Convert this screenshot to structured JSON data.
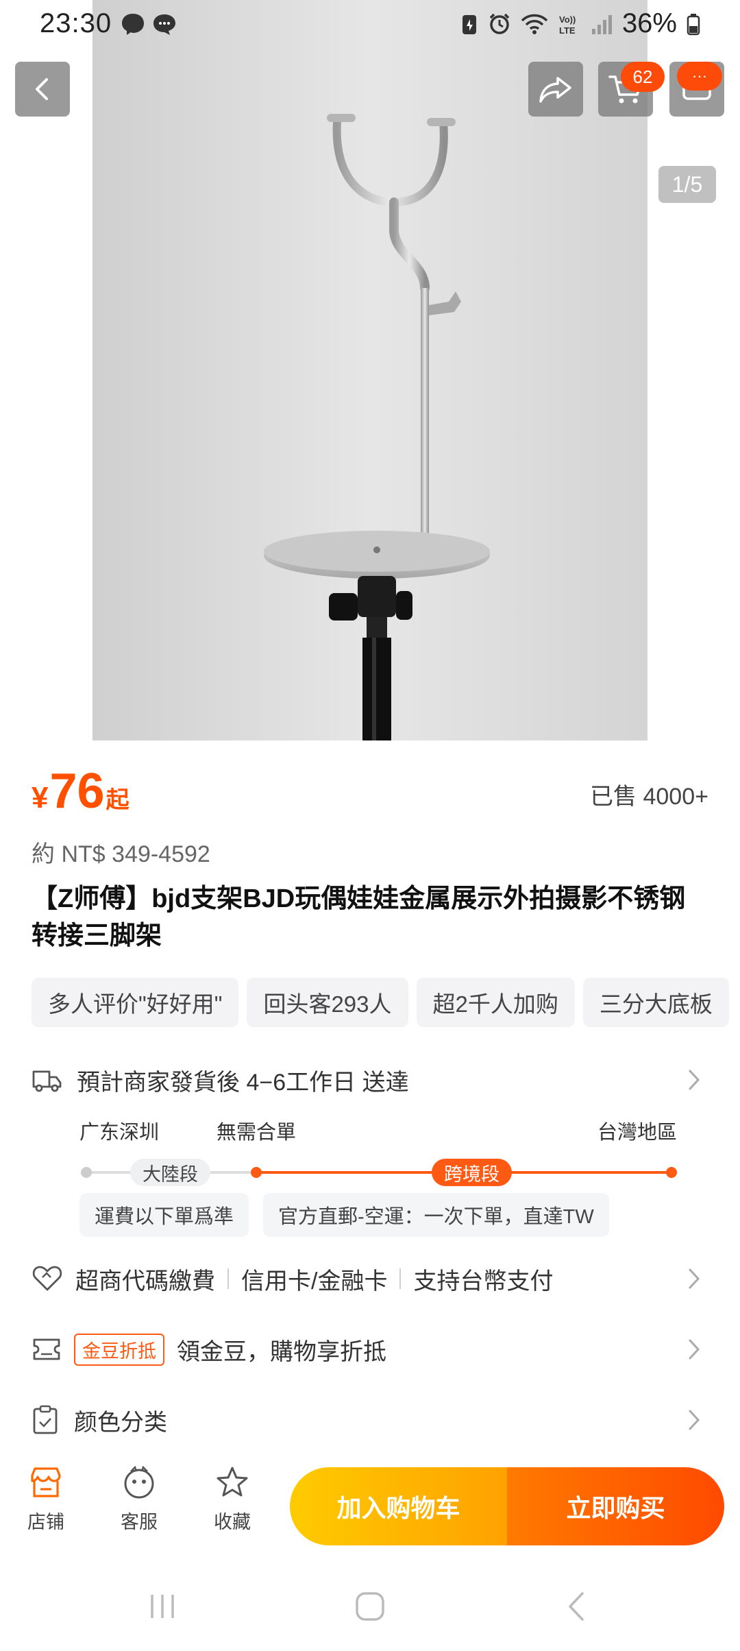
{
  "status_bar": {
    "time": "23:30",
    "battery": "36%",
    "icons": [
      "messenger-icon",
      "chat-icon",
      "battery-saver-icon",
      "alarm-icon",
      "wifi-icon",
      "volte-icon",
      "signal-icon",
      "battery-icon"
    ]
  },
  "header": {
    "cart_badge": "62",
    "more_badge": "···",
    "image_indicator": "1/5"
  },
  "price": {
    "currency": "¥",
    "amount": "76",
    "suffix": "起",
    "sold": "已售 4000+",
    "ntd": "約 NT$ 349-4592"
  },
  "product": {
    "title": "【Z师傅】bjd支架BJD玩偶娃娃金属展示外拍摄影不锈钢转接三脚架"
  },
  "tags": [
    "多人评价\"好好用\"",
    "回头客293人",
    "超2千人加购",
    "三分大底板"
  ],
  "delivery": {
    "text": "預計商家發貨後 4−6工作日 送達",
    "origin": "广东深圳",
    "no_merge": "無需合單",
    "destination": "台灣地區",
    "seg_mainland": "大陸段",
    "seg_cross": "跨境段",
    "note_left": "運費以下單爲準",
    "note_right": "官方直郵-空運：一次下單，直達TW"
  },
  "payment": {
    "items": [
      "超商代碼繳費",
      "信用卡/金融卡",
      "支持台幣支付"
    ]
  },
  "coin": {
    "tag": "金豆折抵",
    "text": "領金豆，購物享折抵"
  },
  "variant": {
    "label": "颜色分类"
  },
  "bottom_bar": {
    "store": "店铺",
    "service": "客服",
    "favorite": "收藏",
    "add_to_cart": "加入购物车",
    "buy_now": "立即购买"
  },
  "colors": {
    "accent": "#ff5000",
    "cta_yellow": "#ffb300",
    "cta_orange": "#ff5500"
  }
}
